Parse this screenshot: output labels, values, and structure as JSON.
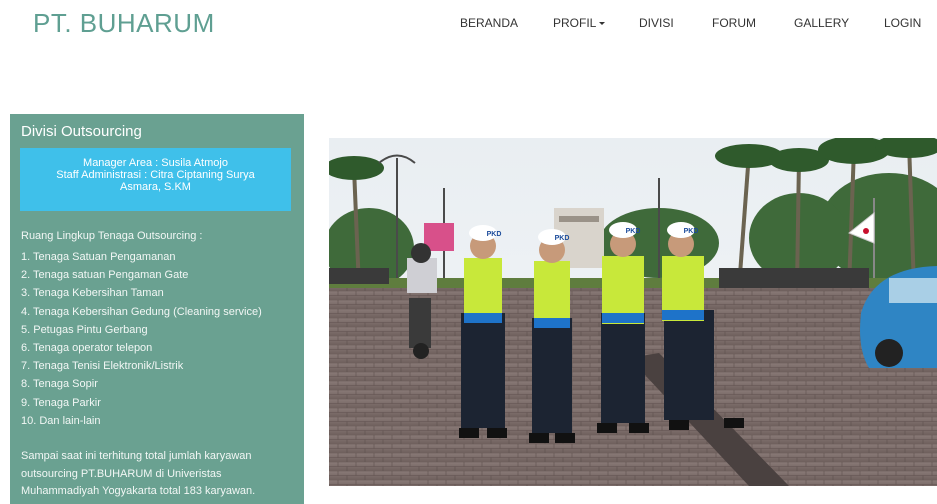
{
  "brand": "PT. BUHARUM",
  "nav": {
    "beranda": "BERANDA",
    "profil": "PROFIL",
    "divisi": "DIVISI",
    "forum": "FORUM",
    "gallery": "GALLERY",
    "login": "LOGIN"
  },
  "panel": {
    "title": "Divisi Outsourcing",
    "manager": "Manager Area : Susila Atmojo",
    "staff": "Staff Administrasi : Citra Ciptaning Surya Asmara, S.KM",
    "scope_title": "Ruang Lingkup Tenaga Outsourcing :",
    "scope_items": [
      "1. Tenaga Satuan Pengamanan",
      "2. Tenaga satuan Pengaman Gate",
      "3. Tenaga Kebersihan Taman",
      "4. Tenaga Kebersihan Gedung (Cleaning service)",
      "5. Petugas Pintu Gerbang",
      "6. Tenaga operator telepon",
      "7. Tenaga Tenisi Elektronik/Listrik",
      "8. Tenaga Sopir",
      "9. Tenaga Parkir",
      "10. Dan lain-lain"
    ],
    "summary": "Sampai saat ini terhitung total jumlah karyawan outsourcing PT.BUHARUM di Univeristas Muhammadiyah Yogyakarta total 183 karyawan."
  },
  "photo": {
    "helmet_text": "PKD"
  },
  "colors": {
    "brand": "#5f9f92",
    "panel_bg": "#6aa191",
    "info_box": "#3fc0ea",
    "vest": "#c8e83a"
  }
}
